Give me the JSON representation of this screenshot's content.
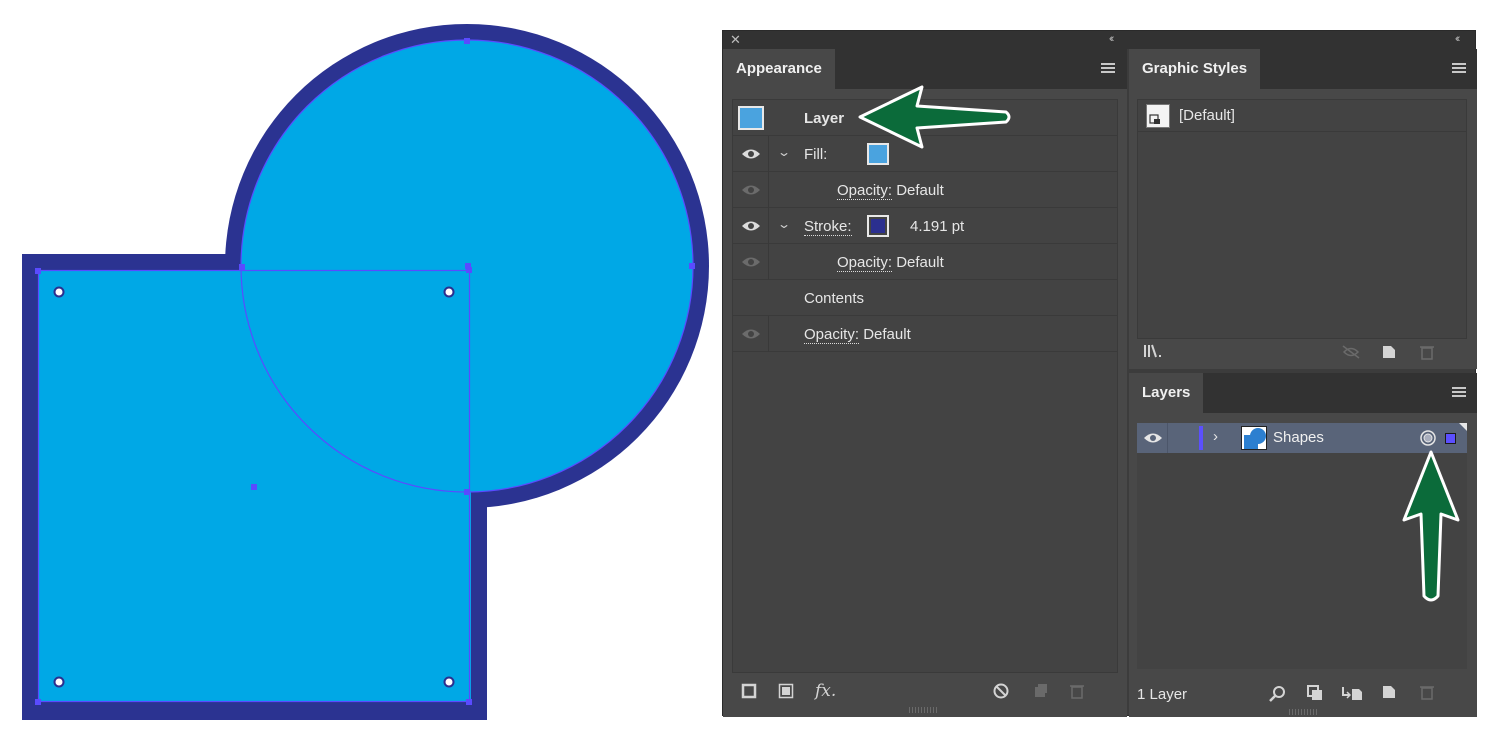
{
  "artwork": {
    "colors": {
      "fill": "#00a8e6",
      "stroke": "#2b3391",
      "selection": "#5a4bff"
    }
  },
  "appearance": {
    "tab_label": "Appearance",
    "header_label": "Layer",
    "fill_label": "Fill:",
    "fill_color": "#4aa3df",
    "fill_opacity_label": "Opacity:",
    "fill_opacity_value": "Default",
    "stroke_label": "Stroke:",
    "stroke_color": "#2b2f8f",
    "stroke_weight": "4.191 pt",
    "stroke_opacity_label": "Opacity:",
    "stroke_opacity_value": "Default",
    "contents_label": "Contents",
    "opacity_label": "Opacity:",
    "opacity_value": "Default",
    "footer_icons": [
      "add-new-stroke-icon",
      "add-new-fill-icon",
      "fx-effect-icon",
      "clear-appearance-icon",
      "duplicate-item-icon",
      "delete-item-icon"
    ]
  },
  "graphic_styles": {
    "tab_label": "Graphic Styles",
    "items": [
      {
        "label": "[Default]"
      }
    ],
    "footer_icons": [
      "libraries-menu-icon",
      "break-link-icon",
      "new-style-icon",
      "delete-style-icon"
    ]
  },
  "layers": {
    "tab_label": "Layers",
    "rows": [
      {
        "name": "Shapes",
        "color": "#5b4fff"
      }
    ],
    "count_label": "1 Layer",
    "footer_icons": [
      "locate-object-icon",
      "clipping-mask-icon",
      "new-sublayer-icon",
      "new-layer-icon",
      "delete-layer-icon"
    ]
  },
  "annotations": {
    "arrow_color": "#0b6b3a"
  }
}
